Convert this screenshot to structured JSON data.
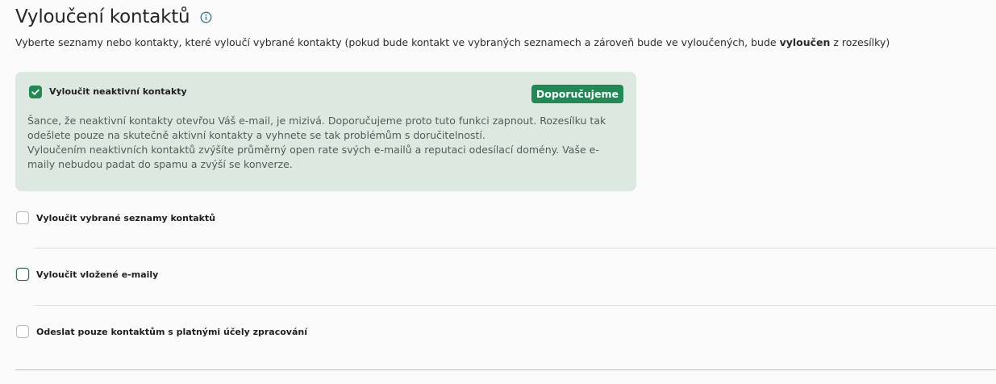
{
  "header": {
    "title": "Vyloučení kontaktů",
    "info_icon": "info-icon"
  },
  "subtitle": {
    "before": "Vyberte seznamy nebo kontakty, které vyloučí vybrané kontakty (pokud bude kontakt ve vybraných seznamech a zároveň bude ve vyloučených, bude ",
    "bold": "vyloučen",
    "after": " z rozesílky)"
  },
  "inactive_card": {
    "checkbox_label": "Vyloučit neaktivní kontakty",
    "checked": true,
    "badge": "Doporučujeme",
    "paragraph1": "Šance, že neaktivní kontakty otevřou Váš e-mail, je mizivá. Doporučujeme proto tuto funkci zapnout. Rozesílku tak odešlete pouze na skutečně aktivní kontakty a vyhnete se tak problémům s doručitelností.",
    "paragraph2": "Vyloučením neaktivních kontaktů zvýšíte průměrný open rate svých e-mailů a reputaci odesílací domény. Vaše e-maily nebudou padat do spamu a zvýší se konverze."
  },
  "options": [
    {
      "label": "Vyloučit vybrané seznamy kontaktů",
      "checked": false
    },
    {
      "label": "Vyloučit vložené e-maily",
      "checked": false
    },
    {
      "label": "Odeslat pouze kontaktům s platnými účely zpracování",
      "checked": false
    }
  ],
  "colors": {
    "accent": "#1f8a54",
    "card_bg": "#dde9e0",
    "info_icon": "#1f7fa8"
  }
}
